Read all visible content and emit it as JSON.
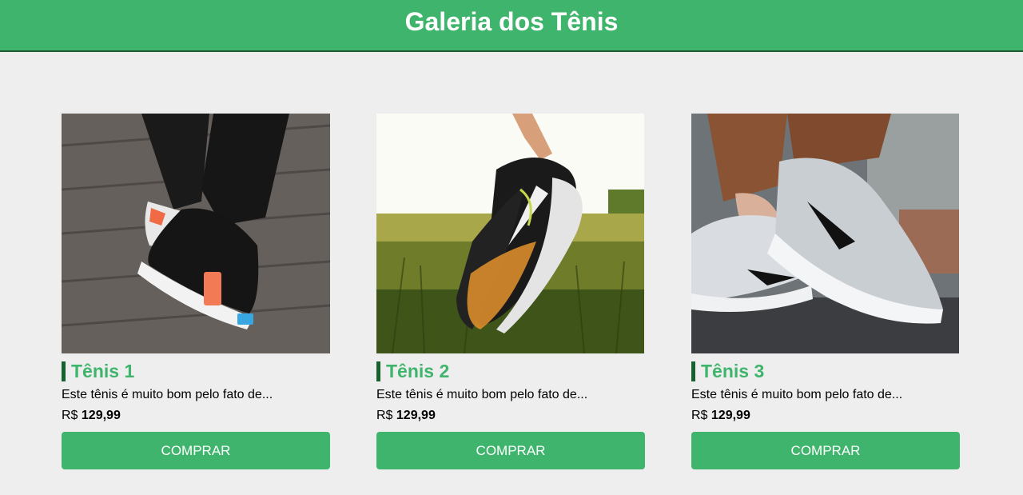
{
  "header": {
    "title": "Galeria dos Tênis"
  },
  "products": [
    {
      "name": "Tênis 1",
      "description": "Este tênis é muito bom pelo fato de...",
      "currency": "R$",
      "price": "129,99",
      "button_label": "COMPRAR",
      "image_icon": "black-sneaker-photo"
    },
    {
      "name": "Tênis 2",
      "description": "Este tênis é muito bom pelo fato de...",
      "currency": "R$",
      "price": "129,99",
      "button_label": "COMPRAR",
      "image_icon": "colorful-sneakers-photo"
    },
    {
      "name": "Tênis 3",
      "description": "Este tênis é muito bom pelo fato de...",
      "currency": "R$",
      "price": "129,99",
      "button_label": "COMPRAR",
      "image_icon": "grey-sneaker-photo"
    }
  ],
  "colors": {
    "accent": "#3fb46c",
    "title_bar": "#17612f",
    "background": "#eeeeee"
  }
}
